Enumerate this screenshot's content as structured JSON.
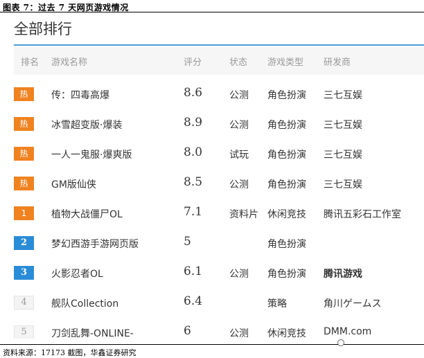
{
  "figure_caption": "图表 7：过去 7 天网页游戏情况",
  "section_title": "全部排行",
  "headers": {
    "rank": "排名",
    "name": "游戏名称",
    "score": "评分",
    "status": "状态",
    "type": "游戏类型",
    "developer": "研发商"
  },
  "rows": [
    {
      "badge": "热",
      "badge_style": "hot",
      "name": "传：四毒高爆",
      "score": "8.6",
      "status": "公测",
      "type": "角色扮演",
      "developer": "三七互娱"
    },
    {
      "badge": "热",
      "badge_style": "hot",
      "name": "冰雪超变版·爆装",
      "score": "8.9",
      "status": "公测",
      "type": "角色扮演",
      "developer": "三七互娱"
    },
    {
      "badge": "热",
      "badge_style": "hot",
      "name": "一人一鬼服·爆爽版",
      "score": "8.0",
      "status": "试玩",
      "type": "角色扮演",
      "developer": "三七互娱"
    },
    {
      "badge": "热",
      "badge_style": "hot",
      "name": "GM版仙侠",
      "score": "8.5",
      "status": "公测",
      "type": "角色扮演",
      "developer": "三七互娱"
    },
    {
      "badge": "1",
      "badge_style": "rank-hot",
      "name": "植物大战僵尸OL",
      "score": "7.1",
      "status": "资料片",
      "type": "休闲竞技",
      "developer": "腾讯五彩石工作室"
    },
    {
      "badge": "2",
      "badge_style": "rank-blue",
      "name": "梦幻西游手游网页版",
      "score": "5",
      "status": "",
      "type": "角色扮演",
      "developer": ""
    },
    {
      "badge": "3",
      "badge_style": "rank-blue",
      "name": "火影忍者OL",
      "score": "6.1",
      "status": "公测",
      "type": "角色扮演",
      "developer": "腾讯游戏"
    },
    {
      "badge": "4",
      "badge_style": "rank-gray",
      "name": "舰队Collection",
      "score": "6.4",
      "status": "",
      "type": "策略",
      "developer": "角川ゲームス"
    },
    {
      "badge": "5",
      "badge_style": "rank-gray",
      "name": "刀剑乱舞-ONLINE-",
      "score": "6",
      "status": "公测",
      "type": "休闲竞技",
      "developer": "DMM.com"
    }
  ],
  "source": "资料来源：17173 截图，华鑫证券研究"
}
